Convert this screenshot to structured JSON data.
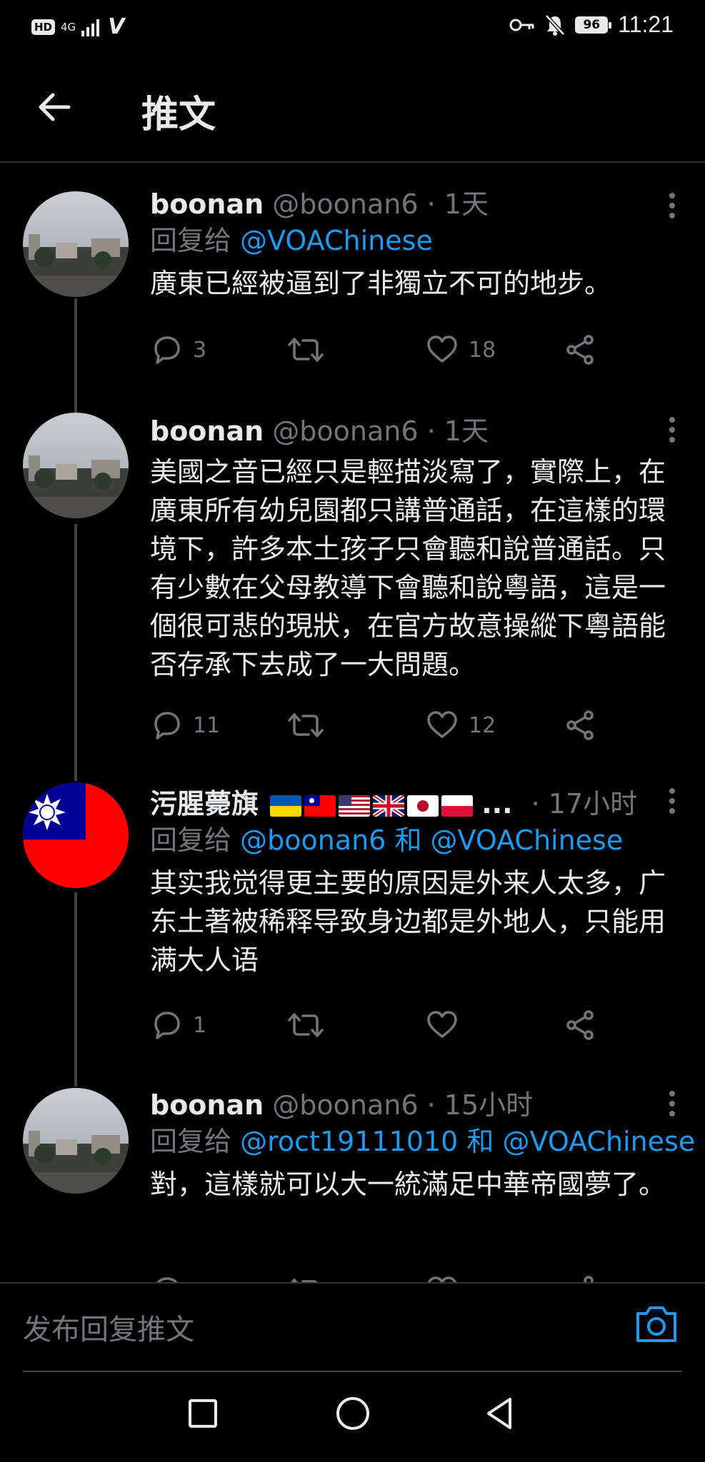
{
  "status_bar": {
    "hd": "HD",
    "network": "4G",
    "battery": "96",
    "time": "11:21"
  },
  "header": {
    "title": "推文"
  },
  "tweets": [
    {
      "name": "boonan",
      "handle": "@boonan6",
      "time": "1天",
      "reply_prefix": "回复给",
      "reply_to": "@VOAChinese",
      "text": "廣東已經被逼到了非獨立不可的地步。",
      "replies": "3",
      "retweets": "",
      "likes": "18"
    },
    {
      "name": "boonan",
      "handle": "@boonan6",
      "time": "1天",
      "text": "美國之音已經只是輕描淡寫了，實際上，在廣東所有幼兒園都只講普通話，在這樣的環境下，許多本土孩子只會聽和說普通話。只有少數在父母教導下會聽和說粵語，這是一個很可悲的現狀，在官方故意操縱下粵語能否存承下去成了一大問題。",
      "replies": "11",
      "retweets": "",
      "likes": "12"
    },
    {
      "name": "污腥薨旗",
      "name_suffix": "...",
      "time": "17小时",
      "reply_prefix": "回复给",
      "reply_to": "@boonan6 和 @VOAChinese",
      "text": "其实我觉得更主要的原因是外来人太多，广东土著被稀释导致身边都是外地人，只能用满大人语",
      "replies": "1",
      "retweets": "",
      "likes": ""
    },
    {
      "name": "boonan",
      "handle": "@boonan6",
      "time": "15小时",
      "reply_prefix": "回复给",
      "reply_to": "@roct19111010 和 @VOAChinese",
      "text": "對，這樣就可以大一統滿足中華帝國夢了。"
    }
  ],
  "reply_bar": {
    "placeholder": "发布回复推文"
  },
  "icons": {
    "back": "arrow-left-icon",
    "more": "more-vertical-icon",
    "reply": "comment-icon",
    "retweet": "retweet-icon",
    "like": "heart-icon",
    "share": "share-icon",
    "camera": "camera-icon",
    "nav_recent": "square-icon",
    "nav_home": "circle-icon",
    "nav_back": "triangle-back-icon"
  },
  "colors": {
    "background": "#000000",
    "text": "#e7e9ea",
    "muted": "#71767b",
    "link": "#1d9bf0",
    "divider": "#2f3336"
  }
}
